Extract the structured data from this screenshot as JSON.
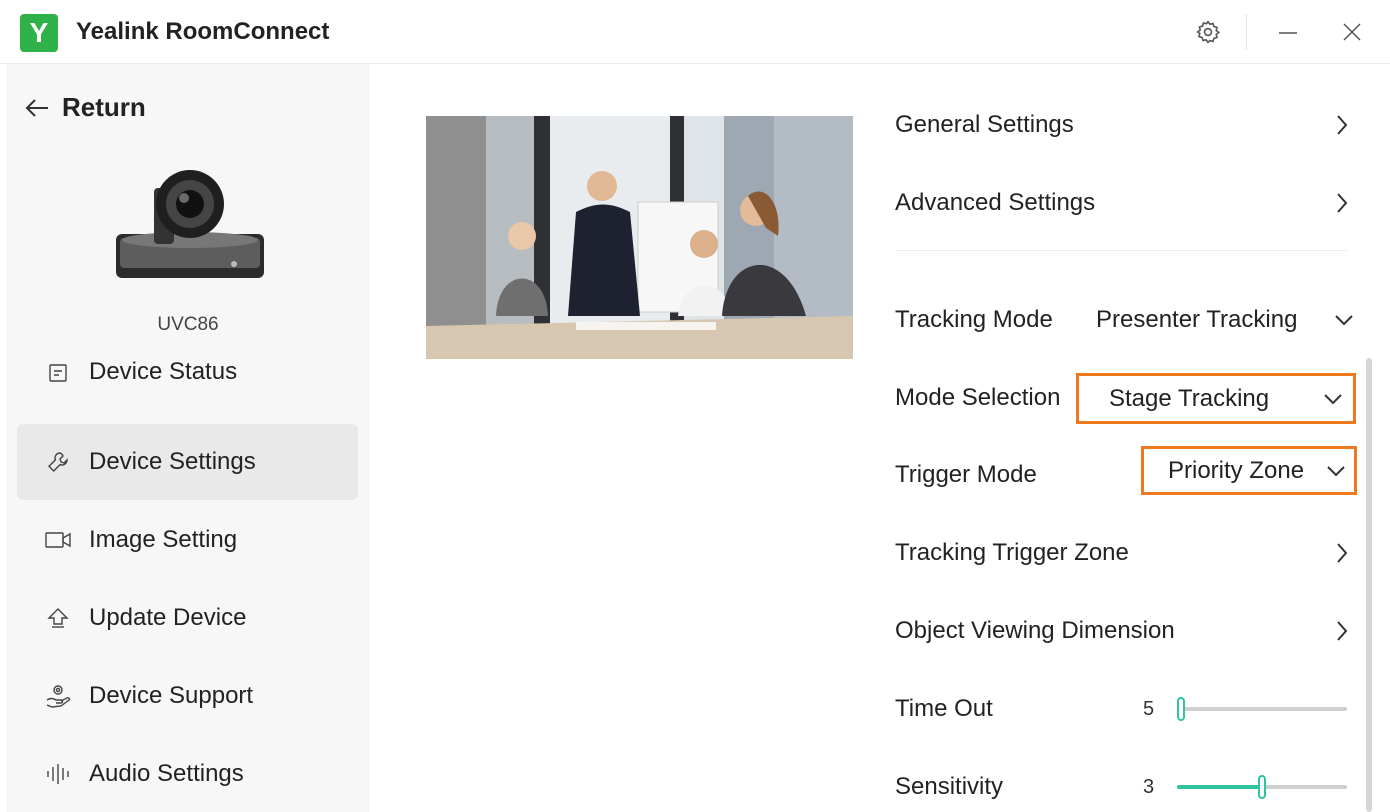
{
  "app": {
    "logo_letter": "Y",
    "title": "Yealink RoomConnect"
  },
  "sidebar": {
    "return_label": "Return",
    "device_name": "UVC86",
    "items": [
      {
        "label": "Device Status",
        "icon": "status-icon",
        "active": false
      },
      {
        "label": "Device Settings",
        "icon": "wrench-icon",
        "active": true
      },
      {
        "label": "Image Setting",
        "icon": "video-camera-icon",
        "active": false
      },
      {
        "label": "Update Device",
        "icon": "update-icon",
        "active": false
      },
      {
        "label": "Device Support",
        "icon": "support-icon",
        "active": false
      },
      {
        "label": "Audio Settings",
        "icon": "audio-wave-icon",
        "active": false
      }
    ]
  },
  "settings": {
    "general": "General Settings",
    "advanced": "Advanced Settings",
    "tracking_mode": {
      "label": "Tracking Mode",
      "value": "Presenter Tracking"
    },
    "mode_selection": {
      "label": "Mode Selection",
      "value": "Stage Tracking"
    },
    "trigger_mode": {
      "label": "Trigger Mode",
      "value": "Priority Zone"
    },
    "tracking_trigger_zone": "Tracking Trigger Zone",
    "object_viewing_dimension": "Object Viewing Dimension",
    "time_out": {
      "label": "Time Out",
      "value": "5",
      "level": 0.0
    },
    "sensitivity": {
      "label": "Sensitivity",
      "value": "3",
      "level": 0.5
    }
  },
  "colors": {
    "brand": "#2fb24a",
    "highlight": "#f0791f",
    "slider": "#2ec4a0"
  }
}
